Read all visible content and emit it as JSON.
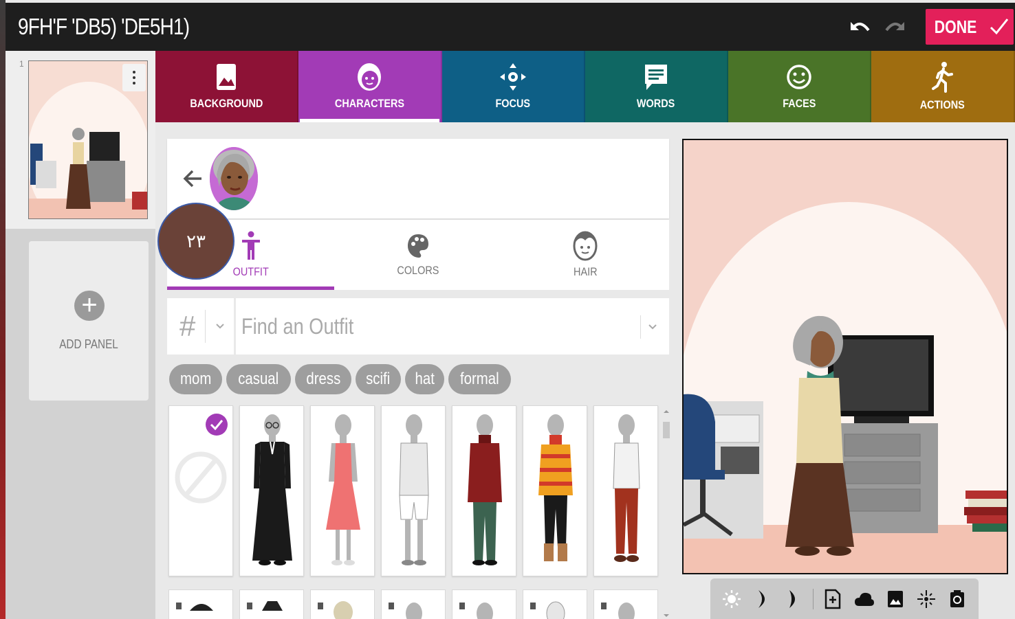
{
  "header": {
    "title": "9FH'F 'DB5) 'DE5H1)",
    "done_label": "DONE"
  },
  "panels": {
    "panel_number": "1",
    "add_panel_label": "ADD PANEL"
  },
  "category_tabs": [
    {
      "label": "BACKGROUND",
      "icon": "image-icon",
      "color": "#8d1236"
    },
    {
      "label": "CHARACTERS",
      "icon": "character-face-icon",
      "color": "#a23bb6",
      "active": true
    },
    {
      "label": "FOCUS",
      "icon": "focus-arrows-icon",
      "color": "#0e5f86"
    },
    {
      "label": "WORDS",
      "icon": "speech-bubble-icon",
      "color": "#0f6763"
    },
    {
      "label": "FACES",
      "icon": "smiley-icon",
      "color": "#4a7428"
    },
    {
      "label": "ACTIONS",
      "icon": "running-person-icon",
      "color": "#9f6d10"
    }
  ],
  "sub_tabs": [
    {
      "label": "OUTFIT",
      "icon": "person-icon",
      "active": true
    },
    {
      "label": "COLORS",
      "icon": "palette-icon"
    },
    {
      "label": "HAIR",
      "icon": "hair-face-icon"
    }
  ],
  "badge_text": "٢٣",
  "search": {
    "hash_symbol": "#",
    "placeholder": "Find an Outfit"
  },
  "tags": [
    "mom",
    "casual",
    "dress",
    "scifi",
    "hat",
    "formal"
  ],
  "outfits": [
    {
      "name": "none",
      "selected": true
    },
    {
      "name": "black-formal-dress",
      "color": "#1a1a1a"
    },
    {
      "name": "pink-dress",
      "color": "#ef7272"
    },
    {
      "name": "white-shirt-shorts",
      "color": "#e8e8e8"
    },
    {
      "name": "red-jacket-green-pants",
      "color": "#8a1e1e"
    },
    {
      "name": "striped-sweater-black-pants",
      "color": "#f0a020"
    },
    {
      "name": "white-blouse-red-pants",
      "color": "#f2f2f2"
    }
  ],
  "colors": {
    "accent": "#a23bb6",
    "done": "#e3205a",
    "topbar": "#1e1e1e"
  }
}
